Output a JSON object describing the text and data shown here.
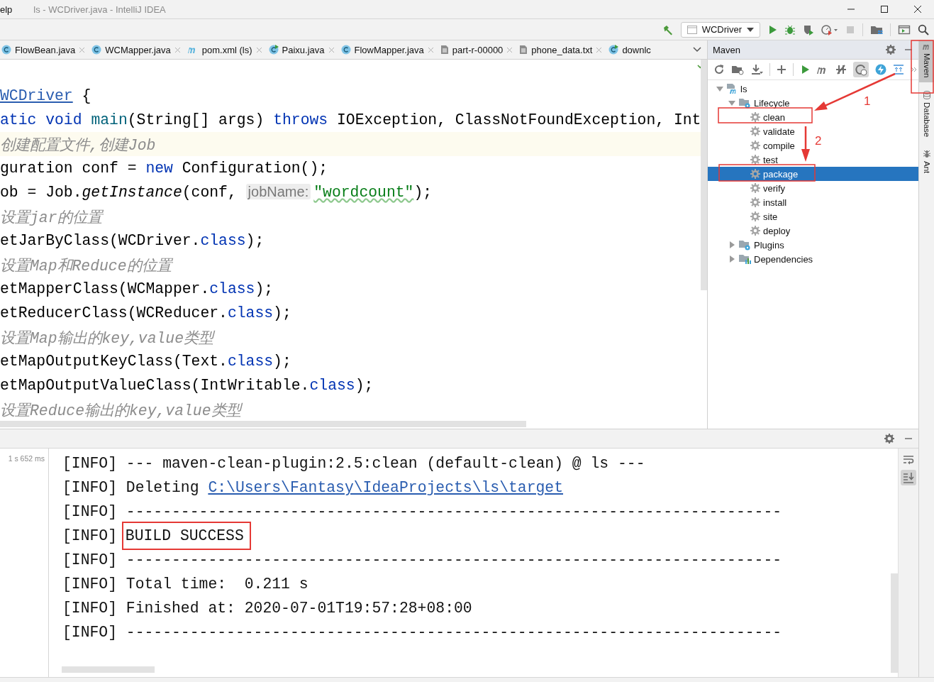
{
  "menu": {
    "label": "elp"
  },
  "window": {
    "title": "ls - WCDriver.java - IntelliJ IDEA"
  },
  "toolbar": {
    "run_configuration": "WCDriver"
  },
  "editor_tabs": [
    {
      "label": "FlowBean.java",
      "kind": "class"
    },
    {
      "label": "WCMapper.java",
      "kind": "class"
    },
    {
      "label": "pom.xml (ls)",
      "kind": "maven"
    },
    {
      "label": "Paixu.java",
      "kind": "runnable"
    },
    {
      "label": "FlowMapper.java",
      "kind": "class"
    },
    {
      "label": "part-r-00000",
      "kind": "file"
    },
    {
      "label": "phone_data.txt",
      "kind": "file"
    },
    {
      "label": "downlc",
      "kind": "runnable"
    }
  ],
  "editor": {
    "lines": [
      {
        "current": false,
        "tokens": [
          {
            "kind": "link",
            "text": "WCDriver"
          },
          {
            "kind": "plain",
            "text": " {"
          }
        ]
      },
      {
        "current": false,
        "tokens": [
          {
            "kind": "keyword",
            "text": "atic void "
          },
          {
            "kind": "method",
            "text": "main"
          },
          {
            "kind": "plain",
            "text": "(String[] args) "
          },
          {
            "kind": "keyword",
            "text": "throws"
          },
          {
            "kind": "plain",
            "text": " IOException, ClassNotFoundException, Int"
          }
        ]
      },
      {
        "current": true,
        "tokens": [
          {
            "kind": "comment",
            "text": "创建配置文件,创建Job"
          }
        ]
      },
      {
        "current": false,
        "tokens": [
          {
            "kind": "plain",
            "text": "guration conf = "
          },
          {
            "kind": "keyword",
            "text": "new"
          },
          {
            "kind": "plain",
            "text": " Configuration();"
          }
        ]
      },
      {
        "current": false,
        "tokens": [
          {
            "kind": "plain",
            "text": "ob = Job."
          },
          {
            "kind": "static",
            "text": "getInstance"
          },
          {
            "kind": "plain",
            "text": "(conf, "
          },
          {
            "kind": "hint",
            "text": "jobName:"
          },
          {
            "kind": "string",
            "text": "\"wordcount\""
          },
          {
            "kind": "plain",
            "text": ");"
          }
        ]
      },
      {
        "current": false,
        "tokens": [
          {
            "kind": "comment",
            "text": "设置jar的位置"
          }
        ]
      },
      {
        "current": false,
        "tokens": [
          {
            "kind": "plain",
            "text": "etJarByClass(WCDriver."
          },
          {
            "kind": "keyword",
            "text": "class"
          },
          {
            "kind": "plain",
            "text": ");"
          }
        ]
      },
      {
        "current": false,
        "tokens": [
          {
            "kind": "comment",
            "text": "设置Map和Reduce的位置"
          }
        ]
      },
      {
        "current": false,
        "tokens": [
          {
            "kind": "plain",
            "text": "etMapperClass(WCMapper."
          },
          {
            "kind": "keyword",
            "text": "class"
          },
          {
            "kind": "plain",
            "text": ");"
          }
        ]
      },
      {
        "current": false,
        "tokens": [
          {
            "kind": "plain",
            "text": "etReducerClass(WCReducer."
          },
          {
            "kind": "keyword",
            "text": "class"
          },
          {
            "kind": "plain",
            "text": ");"
          }
        ]
      },
      {
        "current": false,
        "tokens": [
          {
            "kind": "comment",
            "text": "设置Map输出的key,value类型"
          }
        ]
      },
      {
        "current": false,
        "tokens": [
          {
            "kind": "plain",
            "text": "etMapOutputKeyClass(Text."
          },
          {
            "kind": "keyword",
            "text": "class"
          },
          {
            "kind": "plain",
            "text": ");"
          }
        ]
      },
      {
        "current": false,
        "tokens": [
          {
            "kind": "plain",
            "text": "etMapOutputValueClass(IntWritable."
          },
          {
            "kind": "keyword",
            "text": "class"
          },
          {
            "kind": "plain",
            "text": ");"
          }
        ]
      },
      {
        "current": false,
        "tokens": [
          {
            "kind": "comment",
            "text": "设置Reduce输出的key,value类型"
          }
        ]
      }
    ]
  },
  "maven": {
    "title": "Maven",
    "tree": [
      {
        "label": "ls",
        "kind": "project",
        "expanded": true,
        "selected": false,
        "children": [
          {
            "label": "Lifecycle",
            "kind": "folder",
            "expanded": true,
            "selected": false,
            "children": [
              {
                "label": "clean",
                "kind": "goal",
                "selected": false
              },
              {
                "label": "validate",
                "kind": "goal",
                "selected": false
              },
              {
                "label": "compile",
                "kind": "goal",
                "selected": false
              },
              {
                "label": "test",
                "kind": "goal",
                "selected": false
              },
              {
                "label": "package",
                "kind": "goal",
                "selected": true
              },
              {
                "label": "verify",
                "kind": "goal",
                "selected": false
              },
              {
                "label": "install",
                "kind": "goal",
                "selected": false
              },
              {
                "label": "site",
                "kind": "goal",
                "selected": false
              },
              {
                "label": "deploy",
                "kind": "goal",
                "selected": false
              }
            ]
          },
          {
            "label": "Plugins",
            "kind": "folder",
            "expanded": false,
            "selected": false
          },
          {
            "label": "Dependencies",
            "kind": "deps",
            "expanded": false,
            "selected": false
          }
        ]
      }
    ]
  },
  "side_tabs": [
    {
      "label": "Maven",
      "kind": "maven",
      "selected": true
    },
    {
      "label": "Database",
      "kind": "database",
      "selected": false
    },
    {
      "label": "Ant",
      "kind": "ant",
      "selected": false
    }
  ],
  "run_panel": {
    "elapsed": "1 s 652 ms",
    "lines": [
      [
        {
          "kind": "plain",
          "text": "[INFO] --- maven-clean-plugin:2.5:clean (default-clean) @ ls ---"
        }
      ],
      [
        {
          "kind": "plain",
          "text": "[INFO] Deleting "
        },
        {
          "kind": "link",
          "text": "C:\\Users\\Fantasy\\IdeaProjects\\ls\\target"
        }
      ],
      [
        {
          "kind": "plain",
          "text": "[INFO] ------------------------------------------------------------------------"
        }
      ],
      [
        {
          "kind": "plain",
          "text": "[INFO] "
        },
        {
          "kind": "boxed",
          "text": "BUILD SUCCESS"
        }
      ],
      [
        {
          "kind": "plain",
          "text": "[INFO] ------------------------------------------------------------------------"
        }
      ],
      [
        {
          "kind": "plain",
          "text": "[INFO] Total time:  0.211 s"
        }
      ],
      [
        {
          "kind": "plain",
          "text": "[INFO] Finished at: 2020-07-01T19:57:28+08:00"
        }
      ],
      [
        {
          "kind": "plain",
          "text": "[INFO] ------------------------------------------------------------------------"
        }
      ]
    ]
  },
  "annotations": [
    {
      "kind": "box"
    },
    {
      "kind": "box"
    },
    {
      "kind": "box"
    },
    {
      "kind": "arrow",
      "label": "1"
    },
    {
      "kind": "arrow",
      "label": "2"
    }
  ]
}
